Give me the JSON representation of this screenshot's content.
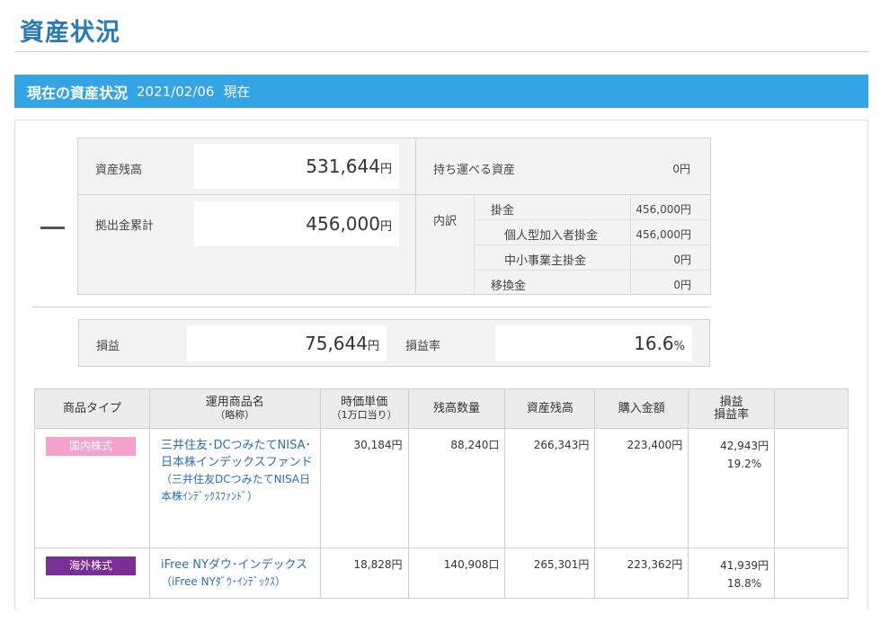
{
  "page": {
    "title": "資産状況"
  },
  "section": {
    "title": "現在の資産状況",
    "date": "2021/02/06",
    "suffix": "現在"
  },
  "summary": {
    "balance": {
      "label": "資産残高",
      "value": "531,644",
      "unit": "円"
    },
    "contributions": {
      "label": "拠出金累計",
      "value": "456,000",
      "unit": "円"
    },
    "portable": {
      "label": "持ち運べる資産",
      "value": "0円"
    },
    "breakdown": {
      "label": "内訳",
      "items": [
        {
          "label": "掛金",
          "value": "456,000円"
        },
        {
          "label": "個人型加入者掛金",
          "value": "456,000円"
        },
        {
          "label": "中小事業主掛金",
          "value": "0円"
        },
        {
          "label": "移換金",
          "value": "0円"
        }
      ]
    }
  },
  "profit": {
    "amount": {
      "label": "損益",
      "value": "75,644",
      "unit": "円"
    },
    "rate": {
      "label": "損益率",
      "value": "16.6",
      "unit": "%"
    }
  },
  "holdings": {
    "headers": {
      "type": "商品タイプ",
      "name": "運用商品名",
      "name_sub": "（略称）",
      "unit_price": "時価単価",
      "unit_price_sub": "（1万口当り）",
      "quantity": "残高数量",
      "balance": "資産残高",
      "purchase": "購入金額",
      "pl": "損益",
      "pl_rate": "損益率"
    },
    "rows": [
      {
        "type": "国内株式",
        "type_color": "#f7a1cf",
        "name": "三井住友･DCつみたてNISA･日本株インデックスファンド",
        "short_name": "（三井住友DCつみたてNISA日本株ｲﾝﾃﾞｯｸｽﾌｧﾝﾄﾞ）",
        "unit_price": "30,184円",
        "quantity": "88,240口",
        "balance": "266,343円",
        "purchase": "223,400円",
        "pl": "42,943円",
        "pl_rate": "19.2%"
      },
      {
        "type": "海外株式",
        "type_color": "#7b2e98",
        "name": "iFree NYダウ･インデックス",
        "short_name": "（iFree NYﾀﾞｳ･ｲﾝﾃﾞｯｸｽ）",
        "unit_price": "18,828円",
        "quantity": "140,908口",
        "balance": "265,301円",
        "purchase": "223,362円",
        "pl": "41,939円",
        "pl_rate": "18.8%"
      }
    ]
  }
}
